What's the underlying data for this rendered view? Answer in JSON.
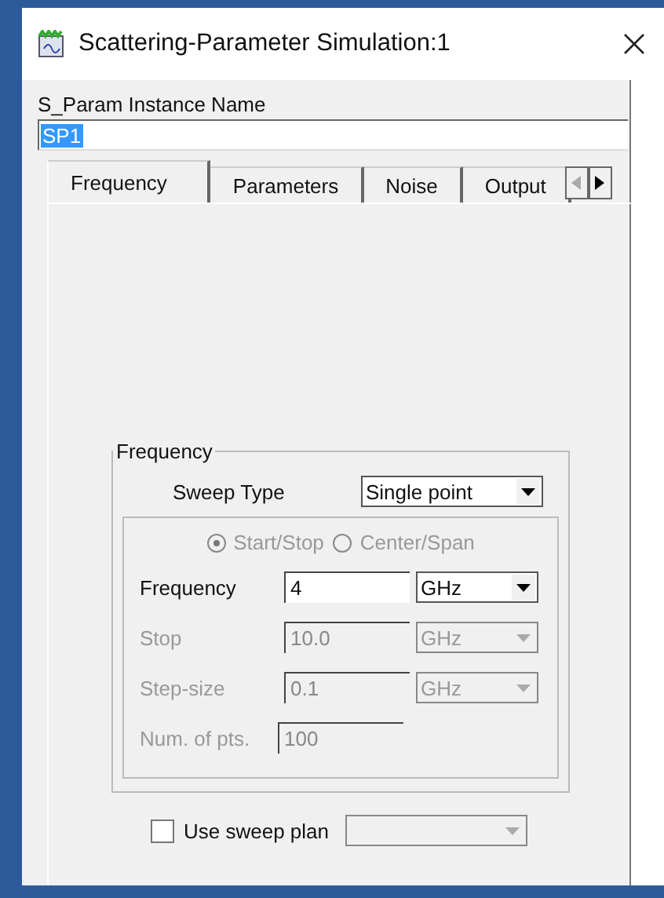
{
  "window": {
    "title": "Scattering-Parameter Simulation:1"
  },
  "instance_name": {
    "label": "S_Param Instance Name",
    "value": "SP1"
  },
  "tabs": [
    {
      "label": "Frequency",
      "selected": true
    },
    {
      "label": "Parameters",
      "selected": false
    },
    {
      "label": "Noise",
      "selected": false
    },
    {
      "label": "Output",
      "selected": false
    }
  ],
  "tab_scroll": {
    "left_disabled": true,
    "right_disabled": false
  },
  "frequency_group": {
    "title": "Frequency",
    "sweep_type": {
      "label": "Sweep Type",
      "value": "Single point"
    },
    "modes": [
      {
        "label": "Start/Stop",
        "selected": true
      },
      {
        "label": "Center/Span",
        "selected": false
      }
    ],
    "modes_disabled": true,
    "rows": [
      {
        "label": "Frequency",
        "value": "4",
        "unit": "GHz",
        "disabled": false
      },
      {
        "label": "Stop",
        "value": "10.0",
        "unit": "GHz",
        "disabled": true
      },
      {
        "label": "Step-size",
        "value": "0.1",
        "unit": "GHz",
        "disabled": true
      },
      {
        "label": "Num. of pts.",
        "value": "100",
        "disabled": true
      }
    ]
  },
  "sweep_plan": {
    "label": "Use sweep plan",
    "checked": false
  }
}
